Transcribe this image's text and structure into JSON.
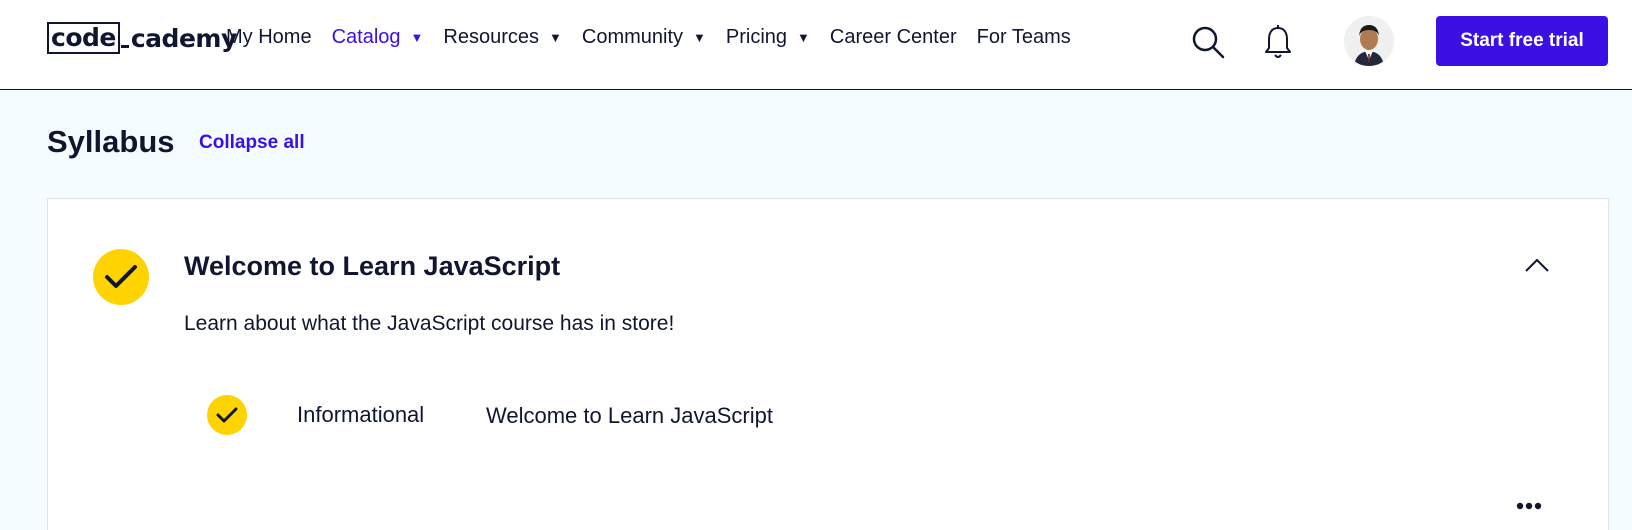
{
  "header": {
    "logo": {
      "part1": "code",
      "part2": "cademy"
    },
    "nav": [
      {
        "label": "My Home",
        "dropdown": false,
        "active": false
      },
      {
        "label": "Catalog",
        "dropdown": true,
        "active": true
      },
      {
        "label": "Resources",
        "dropdown": true,
        "active": false
      },
      {
        "label": "Community",
        "dropdown": true,
        "active": false
      },
      {
        "label": "Pricing",
        "dropdown": true,
        "active": false
      },
      {
        "label": "Career Center",
        "dropdown": false,
        "active": false
      },
      {
        "label": "For Teams",
        "dropdown": false,
        "active": false
      }
    ],
    "icons": {
      "search": "search-icon",
      "notifications": "bell-icon"
    },
    "cta_label": "Start free trial"
  },
  "syllabus": {
    "title": "Syllabus",
    "collapse_label": "Collapse all",
    "module": {
      "title": "Welcome to Learn JavaScript",
      "description": "Learn about what the JavaScript course has in store!",
      "completed": true,
      "lessons": [
        {
          "type": "Informational",
          "title": "Welcome to Learn JavaScript",
          "completed": true
        }
      ]
    }
  },
  "colors": {
    "accent": "#3a10e5",
    "check": "#ffd300",
    "text": "#10162f",
    "page_bg": "#f5fcff"
  }
}
